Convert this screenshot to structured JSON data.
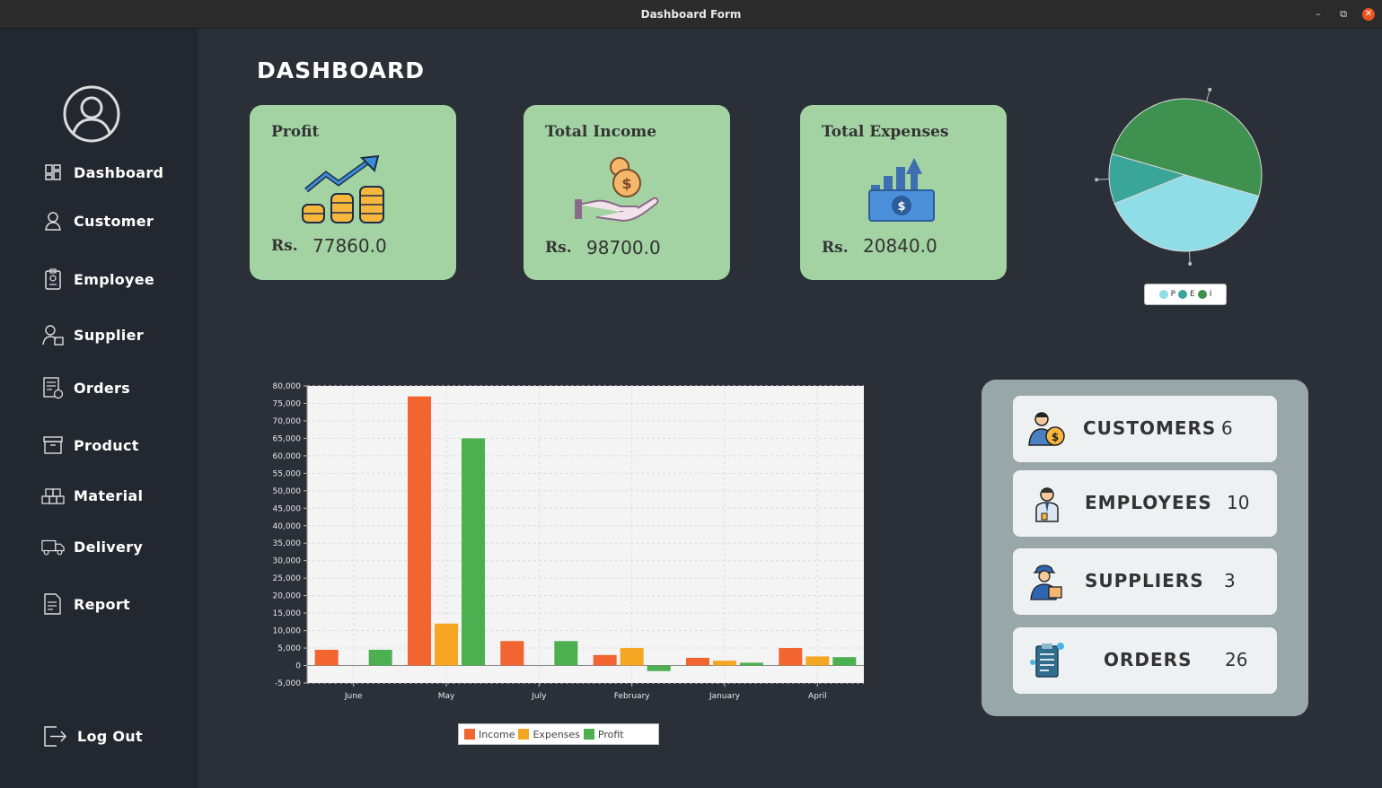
{
  "window": {
    "title": "Dashboard Form"
  },
  "sidebar": {
    "items": [
      {
        "label": "Dashboard",
        "icon": "dashboard-icon"
      },
      {
        "label": "Customer",
        "icon": "user-icon"
      },
      {
        "label": "Employee",
        "icon": "id-badge-icon"
      },
      {
        "label": "Supplier",
        "icon": "supplier-icon"
      },
      {
        "label": "Orders",
        "icon": "orders-icon"
      },
      {
        "label": "Product",
        "icon": "box-icon"
      },
      {
        "label": "Material",
        "icon": "material-icon"
      },
      {
        "label": "Delivery",
        "icon": "truck-icon"
      },
      {
        "label": "Report",
        "icon": "report-icon"
      }
    ],
    "logout": {
      "label": "Log Out",
      "icon": "logout-icon"
    }
  },
  "page": {
    "title": "DASHBOARD"
  },
  "cards": [
    {
      "title": "Profit",
      "currency": "Rs.",
      "amount": "77860.0",
      "icon": "growth-coins-icon"
    },
    {
      "title": "Total Income",
      "currency": "Rs.",
      "amount": "98700.0",
      "icon": "hand-coins-icon"
    },
    {
      "title": "Total Expenses",
      "currency": "Rs.",
      "amount": "20840.0",
      "icon": "money-up-icon"
    }
  ],
  "pie": {
    "legend": [
      {
        "label": "P",
        "color": "#8fdde6"
      },
      {
        "label": "E",
        "color": "#3aa69a"
      },
      {
        "label": "I",
        "color": "#3f9150"
      }
    ]
  },
  "stats": [
    {
      "label": "CUSTOMERS",
      "value": "6",
      "icon": "customer-icon"
    },
    {
      "label": "EMPLOYEES",
      "value": "10",
      "icon": "employee-icon"
    },
    {
      "label": "SUPPLIERS",
      "value": "3",
      "icon": "delivery-person-icon"
    },
    {
      "label": "ORDERS",
      "value": "26",
      "icon": "clipboard-icon"
    }
  ],
  "chart_data": [
    {
      "type": "bar",
      "categories": [
        "June",
        "May",
        "July",
        "February",
        "January",
        "April"
      ],
      "series": [
        {
          "name": "Income",
          "color": "#f26430",
          "values": [
            4500,
            77000,
            7000,
            3000,
            2200,
            5000
          ]
        },
        {
          "name": "Expenses",
          "color": "#f5a623",
          "values": [
            0,
            12000,
            0,
            5000,
            1400,
            2600
          ]
        },
        {
          "name": "Profit",
          "color": "#4caf50",
          "values": [
            4500,
            65000,
            7000,
            -1600,
            800,
            2400
          ]
        }
      ],
      "ylim": [
        -5000,
        80000
      ],
      "yticks": [
        "80,000",
        "75,000",
        "70,000",
        "65,000",
        "60,000",
        "55,000",
        "50,000",
        "45,000",
        "40,000",
        "35,000",
        "30,000",
        "25,000",
        "20,000",
        "15,000",
        "10,000",
        "5,000",
        "0",
        "-5,000"
      ],
      "legend": "bottom",
      "grid": true
    },
    {
      "type": "pie",
      "categories": [
        "P",
        "E",
        "I"
      ],
      "values": [
        77860,
        20840,
        98700
      ],
      "colors": [
        "#8fdde6",
        "#3aa69a",
        "#3f9150"
      ]
    }
  ]
}
